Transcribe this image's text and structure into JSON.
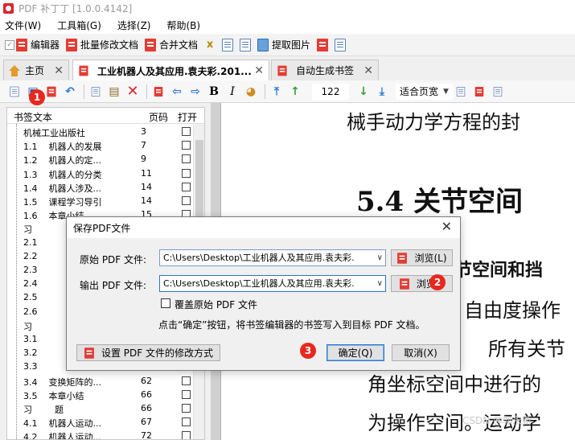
{
  "window": {
    "title": "PDF 补丁丁 [1.0.0.4142]"
  },
  "menu": [
    "文件(W)",
    "工具箱(G)",
    "选择(Z)",
    "帮助(B)"
  ],
  "toolbar1": {
    "editor": "编辑器",
    "batch": "批量修改文档",
    "merge": "合并文档",
    "extract": "提取图片"
  },
  "tabs": [
    {
      "label": "主页"
    },
    {
      "label": "工业机器人及其应用.袁夫彩.201..."
    },
    {
      "label": "自动生成书签"
    }
  ],
  "toolbar2": {
    "page": "122",
    "zoom": "适合页宽",
    "bold": "B",
    "italic": "I"
  },
  "bookmarks": {
    "headers": {
      "text": "书签文本",
      "page": "页码",
      "open": "打开"
    },
    "rows": [
      {
        "text": "机械工业出版社",
        "page": "3"
      },
      {
        "text": "1.1    机器人的发展",
        "page": "7"
      },
      {
        "text": "1.2    机器人的定...",
        "page": "9"
      },
      {
        "text": "1.3    机器人的分类",
        "page": "11"
      },
      {
        "text": "1.4    机器人涉及...",
        "page": "14"
      },
      {
        "text": "1.5    课程学习导引",
        "page": "14"
      },
      {
        "text": "1.6    本章小结",
        "page": "15"
      },
      {
        "text": "习",
        "page": ""
      },
      {
        "text": "2.1",
        "page": ""
      },
      {
        "text": "2.2",
        "page": ""
      },
      {
        "text": "2.3",
        "page": ""
      },
      {
        "text": "2.4",
        "page": ""
      },
      {
        "text": "2.5",
        "page": ""
      },
      {
        "text": "2.6",
        "page": ""
      },
      {
        "text": "习",
        "page": ""
      },
      {
        "text": "3.1",
        "page": ""
      },
      {
        "text": "3.2",
        "page": ""
      },
      {
        "text": "3.3",
        "page": ""
      },
      {
        "text": "3.4    变换矩阵的...",
        "page": "62"
      },
      {
        "text": "3.5    本章小结",
        "page": "66"
      },
      {
        "text": "习        题",
        "page": "66"
      },
      {
        "text": "4.1    机器人运动...",
        "page": "67"
      },
      {
        "text": "4.2    机器人运动...",
        "page": "72"
      }
    ]
  },
  "document": {
    "line1": "械手动力学方程的封",
    "heading": "5.4    关节空间",
    "line3": "关节空间和挡",
    "line4": "自由度操作",
    "line5": "所有关节",
    "line6": "角坐标空间中进行的",
    "line7": "为操作空间。运动学",
    "watermark": "CSDN @郭永新"
  },
  "dialog": {
    "title": "保存PDF文件",
    "source_label": "原始 PDF 文件:",
    "source_value": "C:\\Users\\Desktop\\工业机器人及其应用.袁夫彩.",
    "output_label": "输出 PDF 文件:",
    "output_value": "C:\\Users\\Desktop\\工业机器人及其应用.袁夫彩.",
    "browse1": "浏览(L)",
    "browse2": "浏览...",
    "overwrite": "覆盖原始 PDF 文件",
    "note": "点击“确定”按钮，将书签编辑器的书签写入到目标 PDF 文档。",
    "settings": "设置 PDF 文件的修改方式",
    "ok": "确定(Q)",
    "cancel": "取消(X)"
  },
  "markers": [
    "1",
    "2",
    "3"
  ],
  "colors": {
    "marker": "#e8281e",
    "pdf_icon": "#e33c34",
    "focus_border": "#2b76c9"
  }
}
